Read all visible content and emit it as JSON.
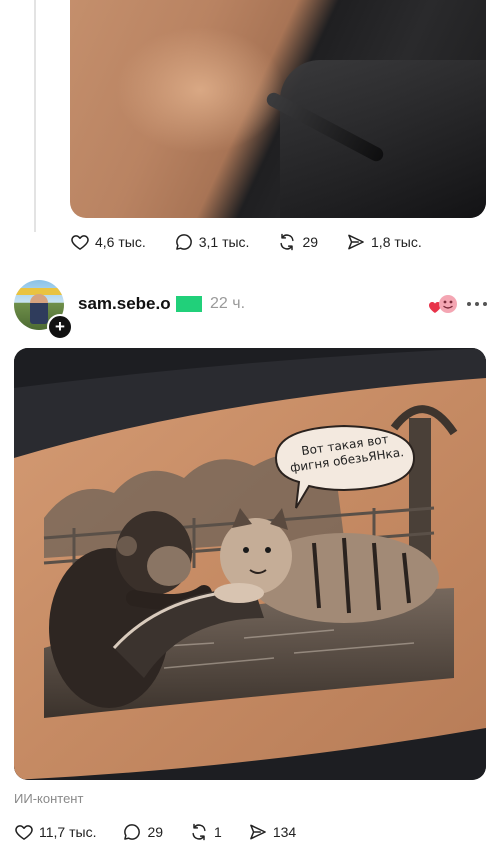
{
  "post1": {
    "stats": {
      "likes": "4,6 тыс.",
      "comments": "3,1 тыс.",
      "reposts": "29",
      "shares": "1,8 тыс."
    }
  },
  "post2": {
    "username": "sam.sebe.o",
    "time": "22 ч.",
    "image_caption": "Вот такая вот фигня обезьЯНка.",
    "ai_label": "ИИ-контент",
    "stats": {
      "likes": "11,7 тыс.",
      "comments": "29",
      "reposts": "1",
      "shares": "134"
    }
  },
  "icons": [
    "heart-icon",
    "comment-icon",
    "repost-icon",
    "share-icon",
    "more-icon",
    "plus-icon"
  ],
  "colors": {
    "censor": "#21d07a",
    "muted": "#8a8a8a",
    "text": "#111111"
  }
}
